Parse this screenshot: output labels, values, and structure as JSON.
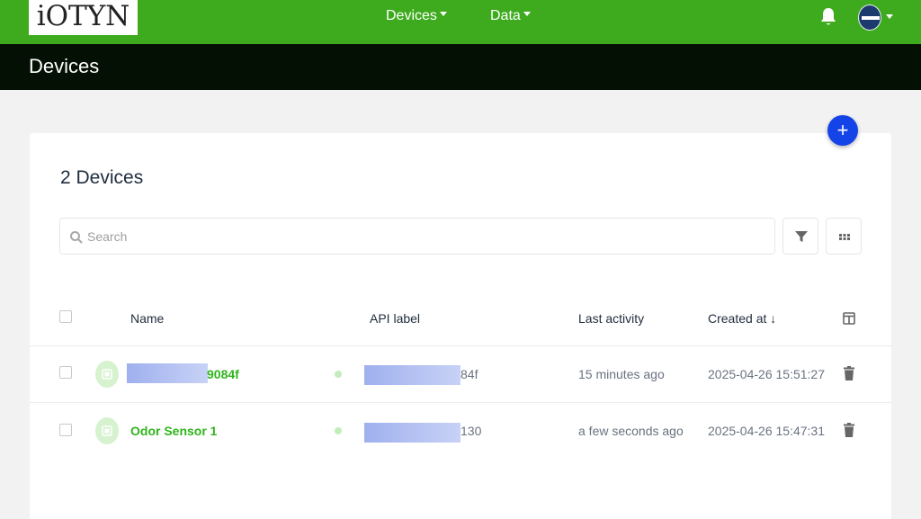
{
  "header": {
    "logo": "iOTYN",
    "nav": [
      {
        "label": "Devices"
      },
      {
        "label": "Data"
      }
    ]
  },
  "page": {
    "title": "Devices"
  },
  "content": {
    "count_label": "2 Devices",
    "search_placeholder": "Search",
    "columns": {
      "name": "Name",
      "api_label": "API label",
      "last_activity": "Last activity",
      "created_at": "Created at ↓"
    },
    "rows": [
      {
        "name_suffix": "9084f",
        "api_suffix": "84f",
        "last_activity": "15 minutes ago",
        "created_at": "2025-04-26 15:51:27"
      },
      {
        "name": "Odor Sensor 1",
        "api_suffix": "130",
        "last_activity": "a few seconds ago",
        "created_at": "2025-04-26 15:47:31"
      }
    ]
  },
  "colors": {
    "topbar": "#3eab1e",
    "titlebar": "#051005",
    "accent_fab": "#1443e8",
    "device_name": "#2fb51c"
  },
  "icons": [
    "bell-icon",
    "avatar",
    "plus-icon",
    "search-icon",
    "filter-icon",
    "grid-icon",
    "columns-icon",
    "chip-icon",
    "trash-icon"
  ]
}
